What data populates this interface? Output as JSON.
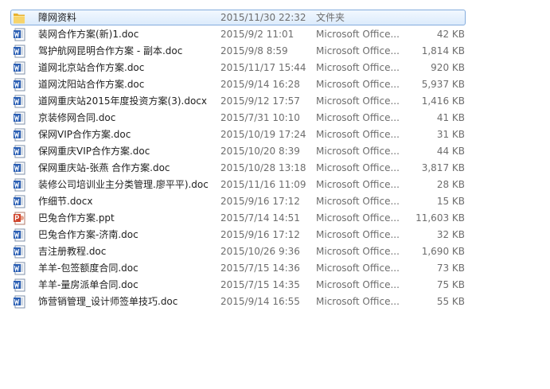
{
  "files": [
    {
      "name": "障网资料",
      "date": "2015/11/30 22:32",
      "type": "文件夹",
      "size": "",
      "icon": "folder",
      "selected": true
    },
    {
      "name": "装网合作方案(新)1.doc",
      "date": "2015/9/2 11:01",
      "type": "Microsoft Office...",
      "size": "42 KB",
      "icon": "word"
    },
    {
      "name": "驾护航网昆明合作方案 - 副本.doc",
      "date": "2015/9/8 8:59",
      "type": "Microsoft Office...",
      "size": "1,814 KB",
      "icon": "word"
    },
    {
      "name": "道网北京站合作方案.doc",
      "date": "2015/11/17 15:44",
      "type": "Microsoft Office...",
      "size": "920 KB",
      "icon": "word"
    },
    {
      "name": "道网沈阳站合作方案.doc",
      "date": "2015/9/14 16:28",
      "type": "Microsoft Office...",
      "size": "5,937 KB",
      "icon": "word"
    },
    {
      "name": "道网重庆站2015年度投资方案(3).docx",
      "date": "2015/9/12 17:57",
      "type": "Microsoft Office...",
      "size": "1,416 KB",
      "icon": "word"
    },
    {
      "name": "京装修网合同.doc",
      "date": "2015/7/31 10:10",
      "type": "Microsoft Office...",
      "size": "41 KB",
      "icon": "word"
    },
    {
      "name": "保网VIP合作方案.doc",
      "date": "2015/10/19 17:24",
      "type": "Microsoft Office...",
      "size": "31 KB",
      "icon": "word"
    },
    {
      "name": "保网重庆VIP合作方案.doc",
      "date": "2015/10/20 8:39",
      "type": "Microsoft Office...",
      "size": "44 KB",
      "icon": "word"
    },
    {
      "name": "保网重庆站-张燕 合作方案.doc",
      "date": "2015/10/28 13:18",
      "type": "Microsoft Office...",
      "size": "3,817 KB",
      "icon": "word"
    },
    {
      "name": "装修公司培训业主分类管理.廖平平).doc",
      "date": "2015/11/16 11:09",
      "type": "Microsoft Office...",
      "size": "28 KB",
      "icon": "word"
    },
    {
      "name": "作细节.docx",
      "date": "2015/9/16 17:12",
      "type": "Microsoft Office...",
      "size": "15 KB",
      "icon": "word"
    },
    {
      "name": "巴兔合作方案.ppt",
      "date": "2015/7/14 14:51",
      "type": "Microsoft Office...",
      "size": "11,603 KB",
      "icon": "powerpoint"
    },
    {
      "name": "巴兔合作方案-济南.doc",
      "date": "2015/9/16 17:12",
      "type": "Microsoft Office...",
      "size": "32 KB",
      "icon": "word"
    },
    {
      "name": "吉注册教程.doc",
      "date": "2015/10/26 9:36",
      "type": "Microsoft Office...",
      "size": "1,690 KB",
      "icon": "word"
    },
    {
      "name": "羊羊-包签额度合同.doc",
      "date": "2015/7/15 14:36",
      "type": "Microsoft Office...",
      "size": "73 KB",
      "icon": "word"
    },
    {
      "name": "羊羊-量房派单合同.doc",
      "date": "2015/7/15 14:35",
      "type": "Microsoft Office...",
      "size": "75 KB",
      "icon": "word"
    },
    {
      "name": "饰营销管理_设计师签单技巧.doc",
      "date": "2015/9/14 16:55",
      "type": "Microsoft Office...",
      "size": "55 KB",
      "icon": "word"
    }
  ]
}
